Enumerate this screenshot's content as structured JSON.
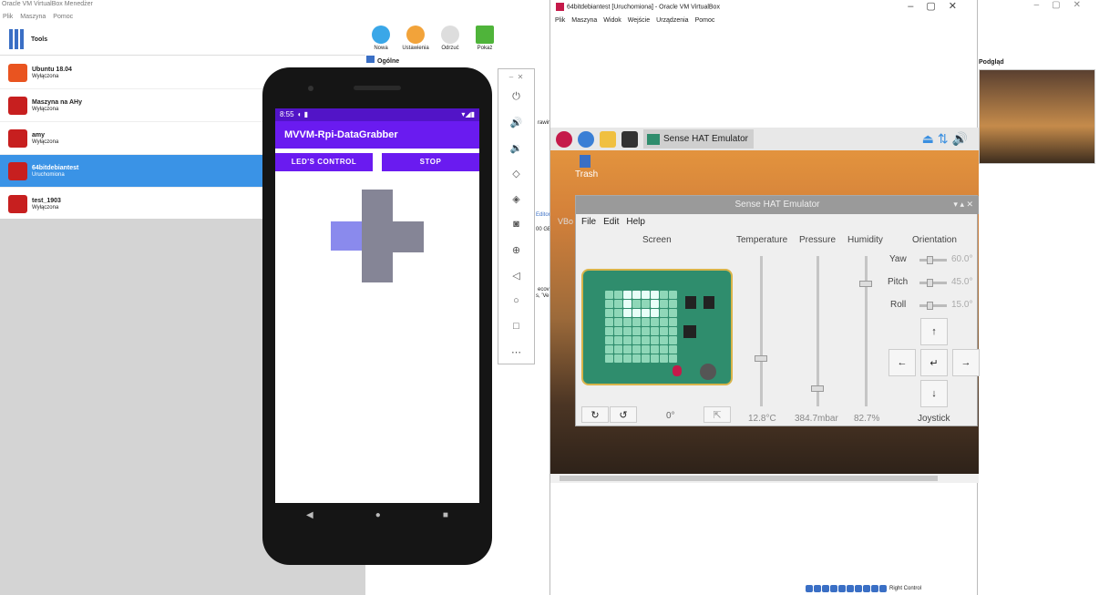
{
  "vbm": {
    "title": "Oracle VM VirtualBox Menedżer",
    "menu": [
      "Plik",
      "Maszyna",
      "Pomoc"
    ],
    "tools_label": "Tools",
    "toolbar": [
      "Nowa",
      "Ustawienia",
      "Odrzuć",
      "Pokaż"
    ],
    "detail_general": "Ogólne",
    "preview_label": "Podgląd",
    "vms": [
      {
        "name": "Ubuntu 18.04",
        "status": "Wyłączona",
        "color": "#e95420"
      },
      {
        "name": "Maszyna na AHy",
        "status": "Wyłączona",
        "color": "#c71f1f"
      },
      {
        "name": "amy",
        "status": "Wyłączona",
        "color": "#c71f1f"
      },
      {
        "name": "64bitdebiantest",
        "status": "Uruchomiona",
        "color": "#c71f1f"
      },
      {
        "name": "test_1903",
        "status": "Wyłączona",
        "color": "#c71f1f"
      }
    ],
    "partial_texts": [
      "rawir",
      "Editor",
      "00 GE",
      "ecov",
      "s, 'Ve"
    ]
  },
  "guest": {
    "title": "64bitdebiantest [Uruchomiona] - Oracle VM VirtualBox",
    "menu": [
      "Plik",
      "Maszyna",
      "Widok",
      "Wejście",
      "Urządzenia",
      "Pomoc"
    ],
    "taskbar_app": "Sense HAT Emulator",
    "trash": "Trash",
    "host_key": "Right Control",
    "desktop_partial": "VBo"
  },
  "sensehat": {
    "title": "Sense HAT Emulator",
    "menu": [
      "File",
      "Edit",
      "Help"
    ],
    "headers": {
      "screen": "Screen",
      "temperature": "Temperature",
      "pressure": "Pressure",
      "humidity": "Humidity",
      "orientation": "Orientation"
    },
    "yaw_label": "Yaw",
    "yaw": "60.0°",
    "pitch_label": "Pitch",
    "pitch": "45.0°",
    "roll_label": "Roll",
    "roll": "15.0°",
    "temp": "12.8°C",
    "pressure": "384.7mbar",
    "humidity": "82.7%",
    "rotation": "0°",
    "joystick": "Joystick",
    "temp_level": 0.32,
    "pressure_level": 0.12,
    "humidity_level": 0.82
  },
  "phone": {
    "time": "8:55",
    "app_title": "MVVM-Rpi-DataGrabber",
    "btn_led": "LED'S CONTROL",
    "btn_stop": "STOP"
  }
}
